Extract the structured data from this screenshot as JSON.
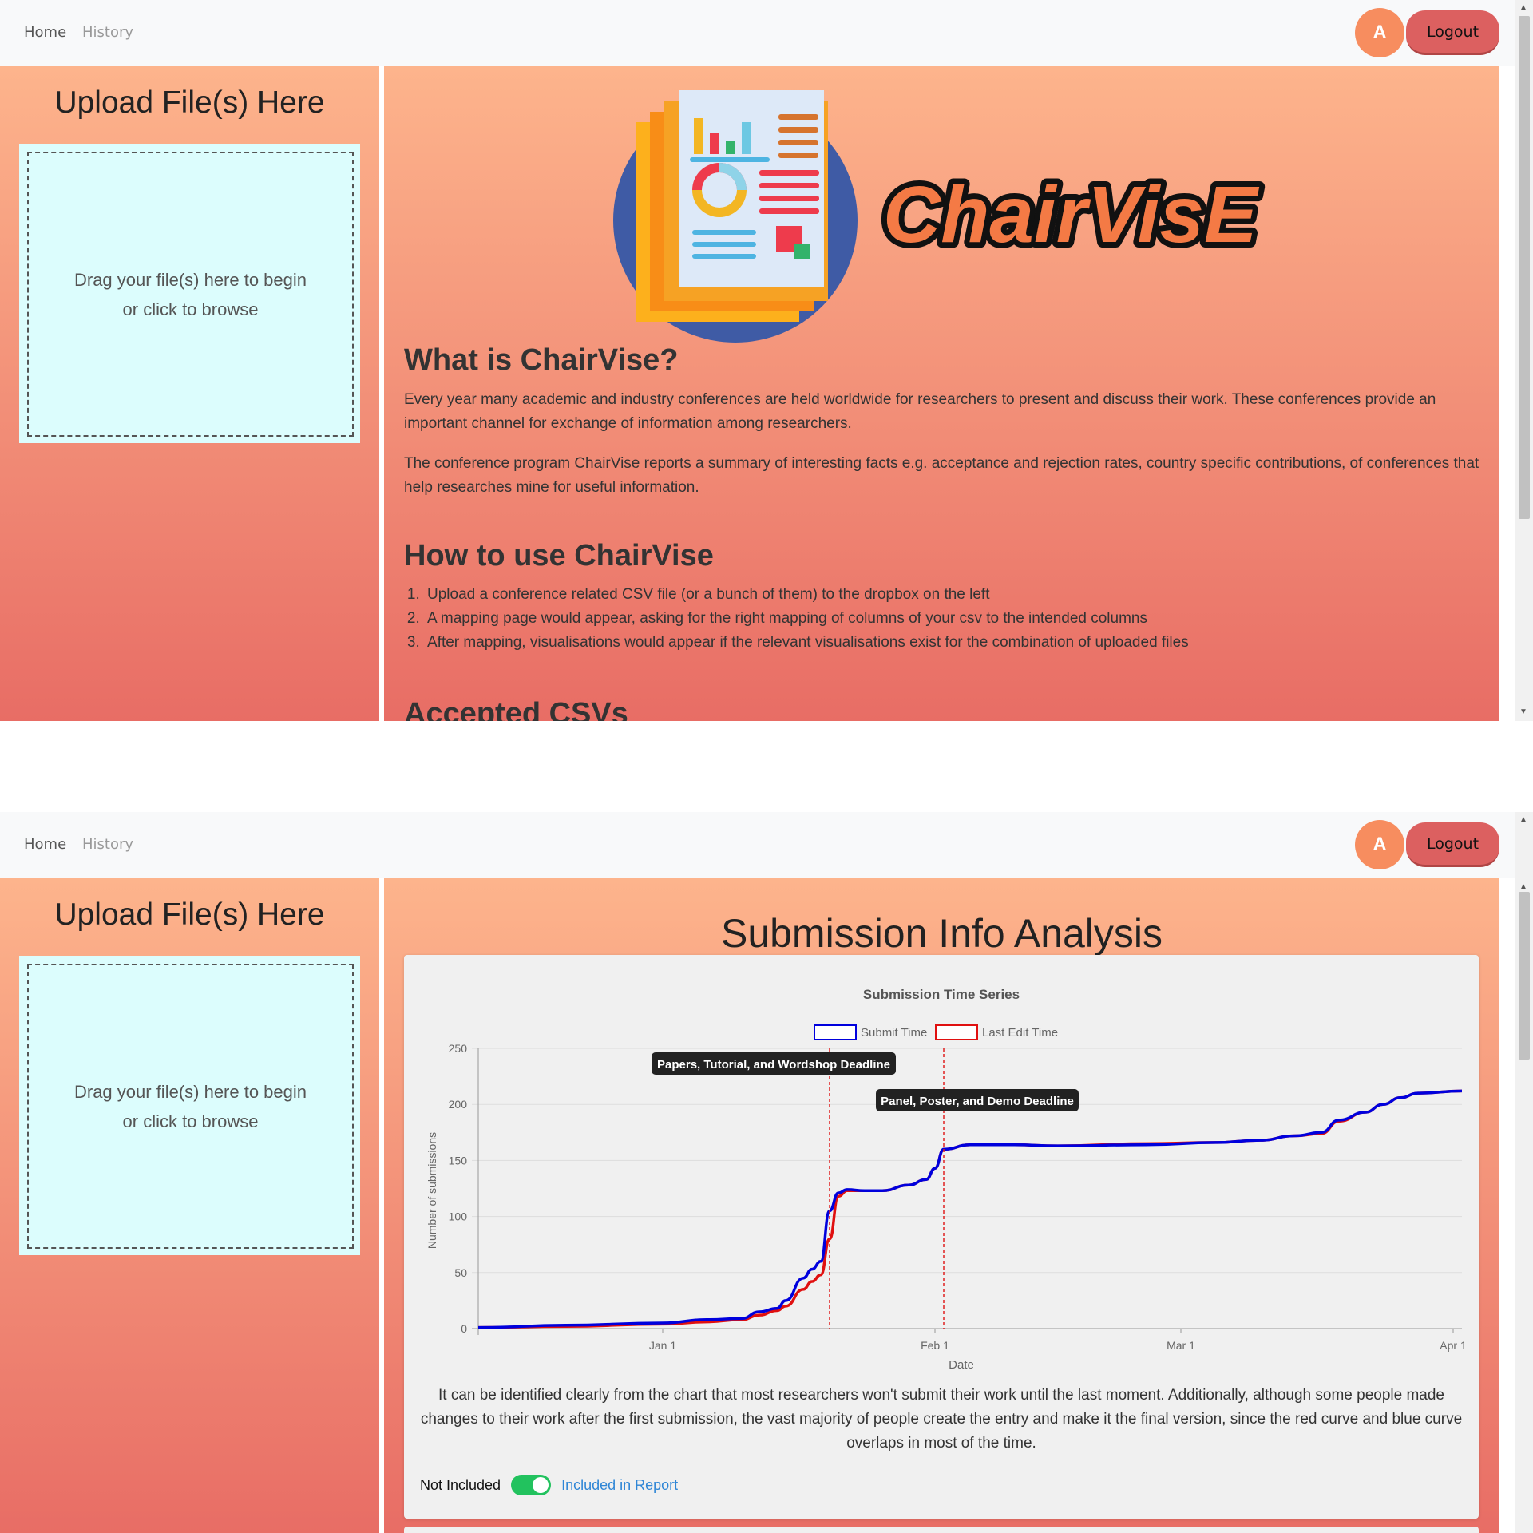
{
  "nav": {
    "home": "Home",
    "history": "History",
    "avatar_initial": "A",
    "logout": "Logout"
  },
  "sidebar": {
    "title": "Upload File(s) Here",
    "drop_line1": "Drag your file(s) here to begin",
    "drop_line2": "or click to browse"
  },
  "home": {
    "logo_text": "ChairVisE",
    "what_title": "What is ChairVise?",
    "what_p1": "Every year many academic and industry conferences are held worldwide for researchers to present and discuss their work. These conferences provide an important channel for exchange of information among researchers.",
    "what_p2": "The conference program ChairVise reports a summary of interesting facts e.g. acceptance and rejection rates, country specific contributions, of conferences that help researches mine for useful information.",
    "how_title": "How to use ChairVise",
    "steps": [
      "Upload a conference related CSV file (or a bunch of them) to the dropbox on the left",
      "A mapping page would appear, asking for the right mapping of columns of your csv to the intended columns",
      "After mapping, visualisations would appear if the relevant visualisations exist for the combination of uploaded files"
    ],
    "accepted_title": "Accepted CSVs"
  },
  "analysis": {
    "page_title": "Submission Info Analysis",
    "description": "It can be identified clearly from the chart that most researchers won't submit their work until the last moment. Additionally, although some people made changes to their work after the first submission, the vast majority of people create the entry and make it the final version, since the red curve and blue curve overlaps in most of the time.",
    "toggle_off_label": "Not Included",
    "toggle_on_label": "Included in Report",
    "toggle_state": true
  },
  "chart_data": {
    "type": "line",
    "title": "Submission Time Series",
    "xlabel": "Date",
    "ylabel": "Number of submissions",
    "ylim": [
      0,
      250
    ],
    "y_ticks": [
      0,
      50,
      100,
      150,
      200,
      250
    ],
    "x_ticks": [
      "Jan 1",
      "Feb 1",
      "Mar 1",
      "Apr 1"
    ],
    "x_range": [
      "2016-12-11",
      "2017-04-02"
    ],
    "grid": true,
    "legend_position": "top-center",
    "series": [
      {
        "name": "Submit Time",
        "color": "#0000dd",
        "x": [
          "2016-12-11",
          "2016-12-21",
          "2017-01-01",
          "2017-01-06",
          "2017-01-10",
          "2017-01-12",
          "2017-01-14",
          "2017-01-15",
          "2017-01-17",
          "2017-01-18",
          "2017-01-19",
          "2017-01-20",
          "2017-01-21",
          "2017-01-22",
          "2017-01-24",
          "2017-01-26",
          "2017-01-29",
          "2017-01-31",
          "2017-02-01",
          "2017-02-02",
          "2017-02-05",
          "2017-02-10",
          "2017-02-15",
          "2017-02-25",
          "2017-03-05",
          "2017-03-10",
          "2017-03-14",
          "2017-03-17",
          "2017-03-19",
          "2017-03-22",
          "2017-03-24",
          "2017-03-26",
          "2017-03-28",
          "2017-04-02"
        ],
        "y": [
          1,
          3,
          5,
          8,
          9,
          15,
          18,
          25,
          45,
          53,
          60,
          105,
          121,
          124,
          123,
          123,
          128,
          133,
          143,
          160,
          164,
          164,
          163,
          164,
          166,
          168,
          172,
          175,
          186,
          193,
          200,
          206,
          210,
          212
        ]
      },
      {
        "name": "Last Edit Time",
        "color": "#e01010",
        "x": [
          "2016-12-11",
          "2016-12-21",
          "2017-01-01",
          "2017-01-06",
          "2017-01-10",
          "2017-01-12",
          "2017-01-14",
          "2017-01-15",
          "2017-01-17",
          "2017-01-18",
          "2017-01-19",
          "2017-01-20",
          "2017-01-21",
          "2017-01-22",
          "2017-01-24",
          "2017-01-26",
          "2017-01-29",
          "2017-01-31",
          "2017-02-01",
          "2017-02-02",
          "2017-02-05",
          "2017-02-10",
          "2017-02-15",
          "2017-02-25",
          "2017-03-05",
          "2017-03-10",
          "2017-03-14",
          "2017-03-17",
          "2017-03-19",
          "2017-03-22",
          "2017-03-24",
          "2017-03-26",
          "2017-03-28",
          "2017-04-02"
        ],
        "y": [
          1,
          2,
          4,
          6,
          8,
          12,
          16,
          20,
          35,
          42,
          48,
          80,
          118,
          123,
          123,
          123,
          128,
          133,
          143,
          160,
          164,
          164,
          163,
          165,
          166,
          168,
          172,
          174,
          185,
          193,
          200,
          206,
          210,
          212
        ]
      }
    ],
    "annotations": [
      {
        "label": "Papers, Tutorial, and Wordshop Deadline",
        "x": "2017-01-20"
      },
      {
        "label": "Panel, Poster, and Demo Deadline",
        "x": "2017-02-02"
      }
    ]
  },
  "colors": {
    "gradient_top": "#fdb48c",
    "gradient_bottom": "#e86d65",
    "dropzone_bg": "#dcfdfd",
    "avatar": "#f78d5f",
    "logout": "#dc6060",
    "toggle": "#22c25e"
  }
}
